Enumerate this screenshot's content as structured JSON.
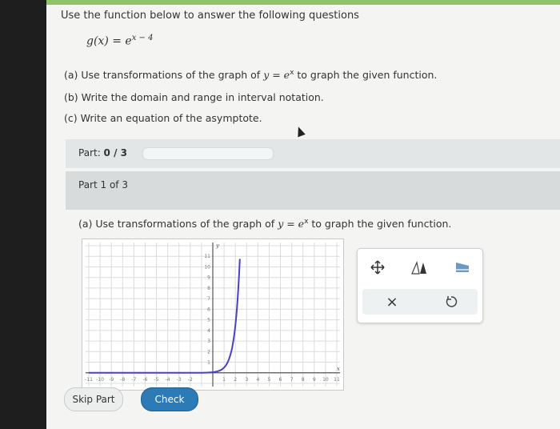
{
  "intro": "Use the function below to answer the following questions",
  "function": {
    "lhs": "g(x) = e",
    "exponent": "x − 4"
  },
  "questions": {
    "a_prefix": "(a) Use transformations of the graph of ",
    "a_formula": "y = e",
    "a_formula_exp": "x",
    "a_suffix": " to graph the given function.",
    "b": "(b) Write the domain and range in interval notation.",
    "c": "(c) Write an equation of the asymptote."
  },
  "part": {
    "label": "Part: ",
    "value": "0 / 3",
    "progress": 0
  },
  "part_header": "Part 1 of 3",
  "question_a": {
    "prefix": "(a) Use transformations of the graph of ",
    "formula": "y = e",
    "formula_exp": "x",
    "suffix": " to graph the given function."
  },
  "graph": {
    "x_ticks": [
      "-11",
      "-10",
      "-9",
      "-8",
      "-7",
      "-6",
      "-5",
      "-4",
      "-3",
      "-2",
      "1",
      "2",
      "3",
      "4",
      "5",
      "6",
      "7",
      "8",
      "9",
      "10",
      "11"
    ],
    "y_ticks": [
      "11",
      "10",
      "9",
      "8",
      "7",
      "6",
      "5",
      "4",
      "3",
      "2",
      "1"
    ],
    "x_axis_label": "x",
    "y_axis_label": "y",
    "curve_color": "#4a3fc9"
  },
  "tools": {
    "move": "move-icon",
    "line": "graph-tool-icon",
    "eraser": "eraser-icon",
    "clear": "×",
    "undo": "undo-icon"
  },
  "buttons": {
    "skip": "Skip Part",
    "check": "Check"
  },
  "colors": {
    "accent": "#2c7bb6",
    "topbar": "#8fc46a"
  }
}
